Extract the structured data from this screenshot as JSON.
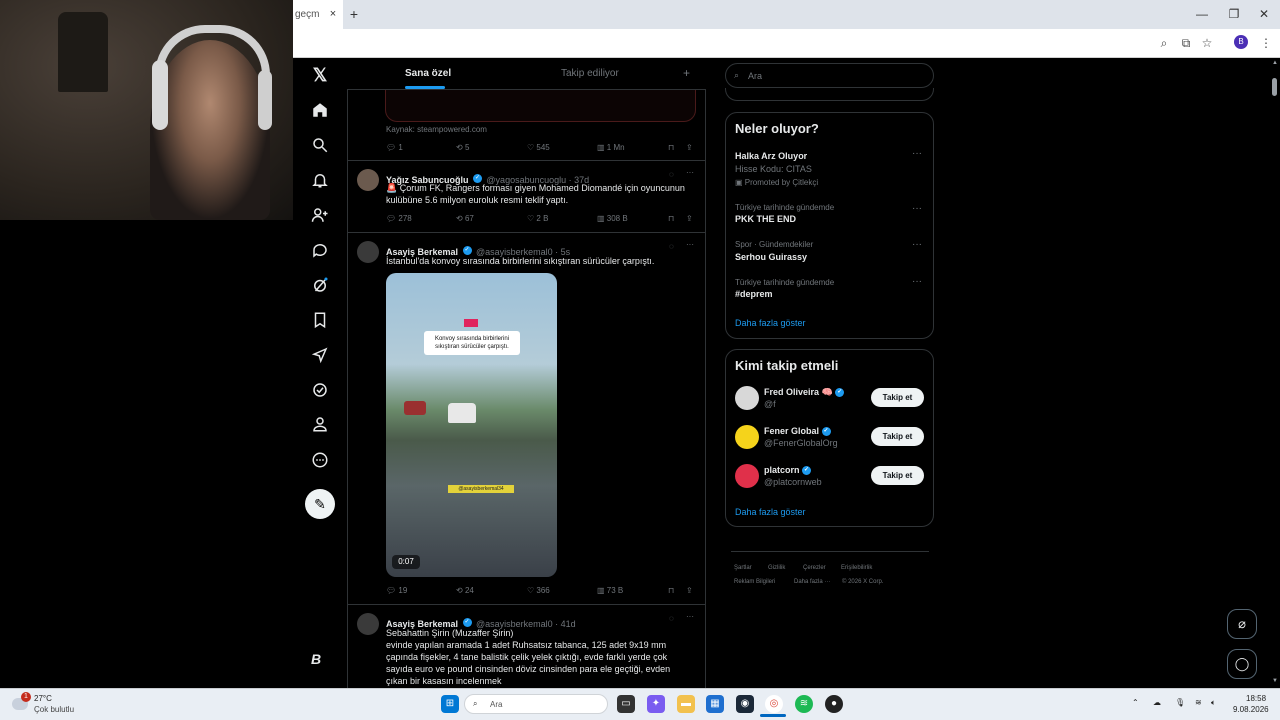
{
  "browser": {
    "tab_title": "geçm",
    "tab_close": "×",
    "new_tab": "+",
    "win_min": "—",
    "win_max": "❐",
    "win_close": "✕",
    "profile_initial": "B"
  },
  "timeline": {
    "tabs": [
      {
        "label": "Sana özel",
        "active": true
      },
      {
        "label": "Takip ediliyor",
        "active": false
      }
    ],
    "add_tab": "+",
    "prev_tweet": {
      "source": "Kaynak: steampowered.com",
      "replies": "1",
      "retweets": "5",
      "likes": "545",
      "views": "1 Mn"
    },
    "tweets": [
      {
        "name": "Yağız Sabuncuoğlu",
        "handle": "@yagosabuncuoglu · 37d",
        "text": "🚨 Çorum FK, Rangers forması giyen Mohamed Diomandé için oyuncunun kulübüne 5.6 milyon euroluk resmi teklif yaptı.",
        "replies": "278",
        "retweets": "67",
        "likes": "2 B",
        "views": "308 B"
      },
      {
        "name": "Asayiş Berkemal",
        "handle": "@asayisberkemal0 · 5s",
        "text": "İstanbul'da konvoy sırasında birbirlerini sıkıştıran sürücüler çarpıştı.",
        "video_caption": "Konvoy sırasında birbirlerini sıkıştıran sürücüler çarpıştı.",
        "video_tag": "@asayisberkemal34",
        "duration": "0:07",
        "replies": "19",
        "retweets": "24",
        "likes": "366",
        "views": "73 B"
      },
      {
        "name": "Asayiş Berkemal",
        "handle": "@asayisberkemal0 · 41d",
        "text_lines": [
          "Sebahattin Şirin (Muzaffer Şirin)",
          "evinde yapılan aramada 1 adet Ruhsatsız tabanca, 125 adet 9x19 mm",
          "çapında fişekler, 4 tane balistik çelik yelek çıktığı, evde farklı yerde çok",
          "sayıda euro ve pound cinsinden döviz cinsinden para ele geçtiği, evden",
          "çıkan bir kasasın incelenmek"
        ]
      }
    ]
  },
  "sidebar": {
    "search_placeholder": "Ara",
    "trends_title": "Neler oluyor?",
    "trends": [
      {
        "meta": "",
        "name": "Halka Arz Oluyor",
        "sub": "Hisse Kodu: CITAS",
        "promo": "Promoted by Çitlekçi"
      },
      {
        "meta": "Türkiye tarihinde gündemde",
        "name": "PKK THE END"
      },
      {
        "meta": "Spor · Gündemdekiler",
        "name": "Serhou Guirassy"
      },
      {
        "meta": "Türkiye tarihinde gündemde",
        "name": "#deprem"
      }
    ],
    "show_more": "Daha fazla göster",
    "who_title": "Kimi takip etmeli",
    "who": [
      {
        "name": "Fred Oliveira 🧠",
        "handle": "@f",
        "button": "Takip et"
      },
      {
        "name": "Fener Global",
        "handle": "@FenerGlobalOrg",
        "button": "Takip et"
      },
      {
        "name": "platcorn",
        "handle": "@platcornweb",
        "button": "Takip et"
      }
    ],
    "who_more": "Daha fazla göster",
    "footer_row1": [
      "Şartlar",
      "Gizlilik",
      "Çerezler",
      "Erişilebilirlik"
    ],
    "footer_row2": [
      "Reklam Bilgileri",
      "Daha fazla ···",
      "© 2026 X Corp."
    ]
  },
  "taskbar": {
    "weather_temp": "27°C",
    "weather_desc": "Çok bulutlu",
    "weather_badge": "1",
    "search_placeholder": "Ara",
    "time": "18:58",
    "date": "9.08.2026"
  },
  "colors": {
    "accent": "#1d9bf0",
    "bg": "#000000",
    "text": "#e7e9ea",
    "muted": "#71767b",
    "border": "#2f3336"
  }
}
